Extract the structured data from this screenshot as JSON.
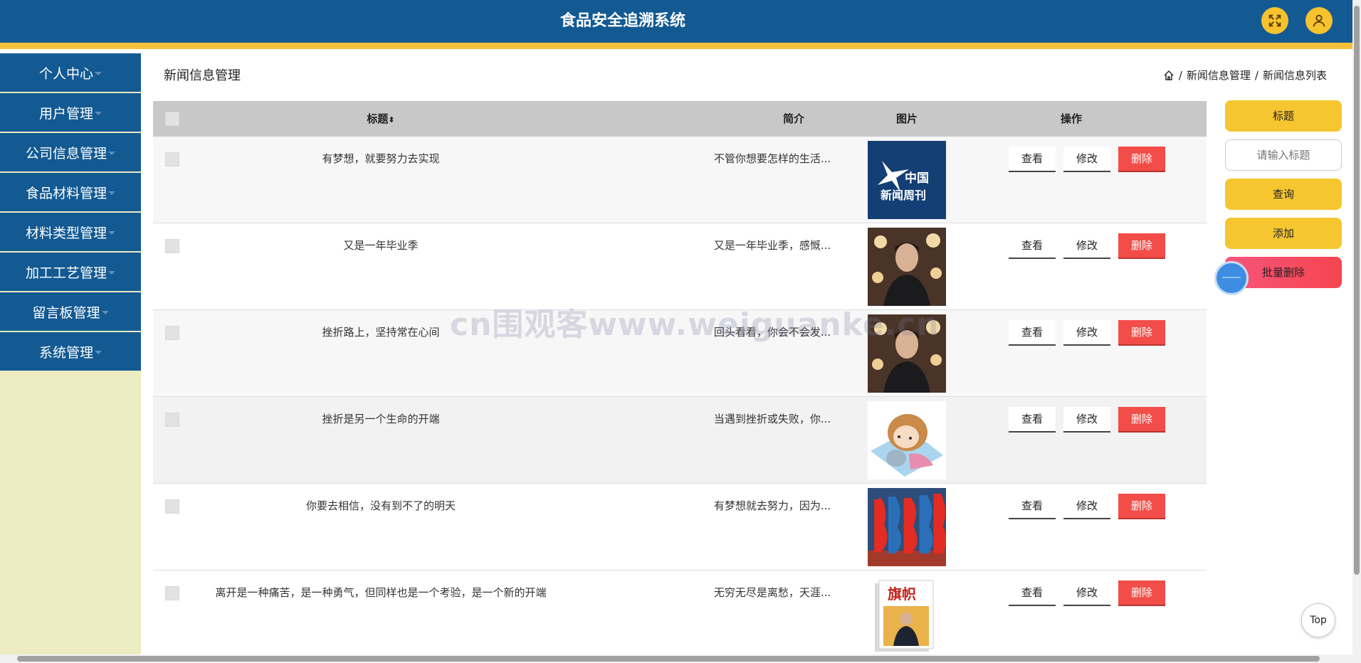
{
  "header": {
    "title": "食品安全追溯系统",
    "fullscreen_icon": "expand-icon",
    "user_icon": "user-icon",
    "accent": "#135a93",
    "stripe": "#f5c13a"
  },
  "sidebar": {
    "items": [
      {
        "label": "个人中心"
      },
      {
        "label": "用户管理"
      },
      {
        "label": "公司信息管理"
      },
      {
        "label": "食品材料管理"
      },
      {
        "label": "材料类型管理"
      },
      {
        "label": "加工工艺管理"
      },
      {
        "label": "留言板管理"
      },
      {
        "label": "系统管理"
      }
    ]
  },
  "page": {
    "title": "新闻信息管理",
    "breadcrumb": [
      "新闻信息管理",
      "新闻信息列表"
    ],
    "breadcrumb_sep": "/"
  },
  "table": {
    "headers": {
      "title": "标题",
      "intro": "简介",
      "image": "图片",
      "actions": "操作"
    },
    "action_labels": {
      "view": "查看",
      "edit": "修改",
      "delete": "删除"
    },
    "rows": [
      {
        "title": "有梦想，就要努力去实现",
        "intro": "不管你想要怎样的生活...",
        "image": "news-weekly"
      },
      {
        "title": "又是一年毕业季",
        "intro": "又是一年毕业季，感慨...",
        "image": "portrait-lights"
      },
      {
        "title": "挫折路上，坚持常在心间",
        "intro": "回头看看，你会不会发...",
        "image": "portrait-lights"
      },
      {
        "title": "挫折是另一个生命的开端",
        "intro": "当遇到挫折或失败，你...",
        "image": "sleeping-girl"
      },
      {
        "title": "你要去相信，没有到不了的明天",
        "intro": "有梦想就去努力，因为...",
        "image": "flags"
      },
      {
        "title": "离开是一种痛苦，是一种勇气，但同样也是一个考验，是一个新的开端",
        "intro": "无穷无尽是离愁，天涯...",
        "image": "magazine"
      }
    ]
  },
  "right_panel": {
    "title_label": "标题",
    "search_placeholder": "请输入标题",
    "query": "查询",
    "add": "添加",
    "batch_delete": "批量删除"
  },
  "top_button": "Top",
  "watermark": "cn围观客www.weiguanke.cn"
}
